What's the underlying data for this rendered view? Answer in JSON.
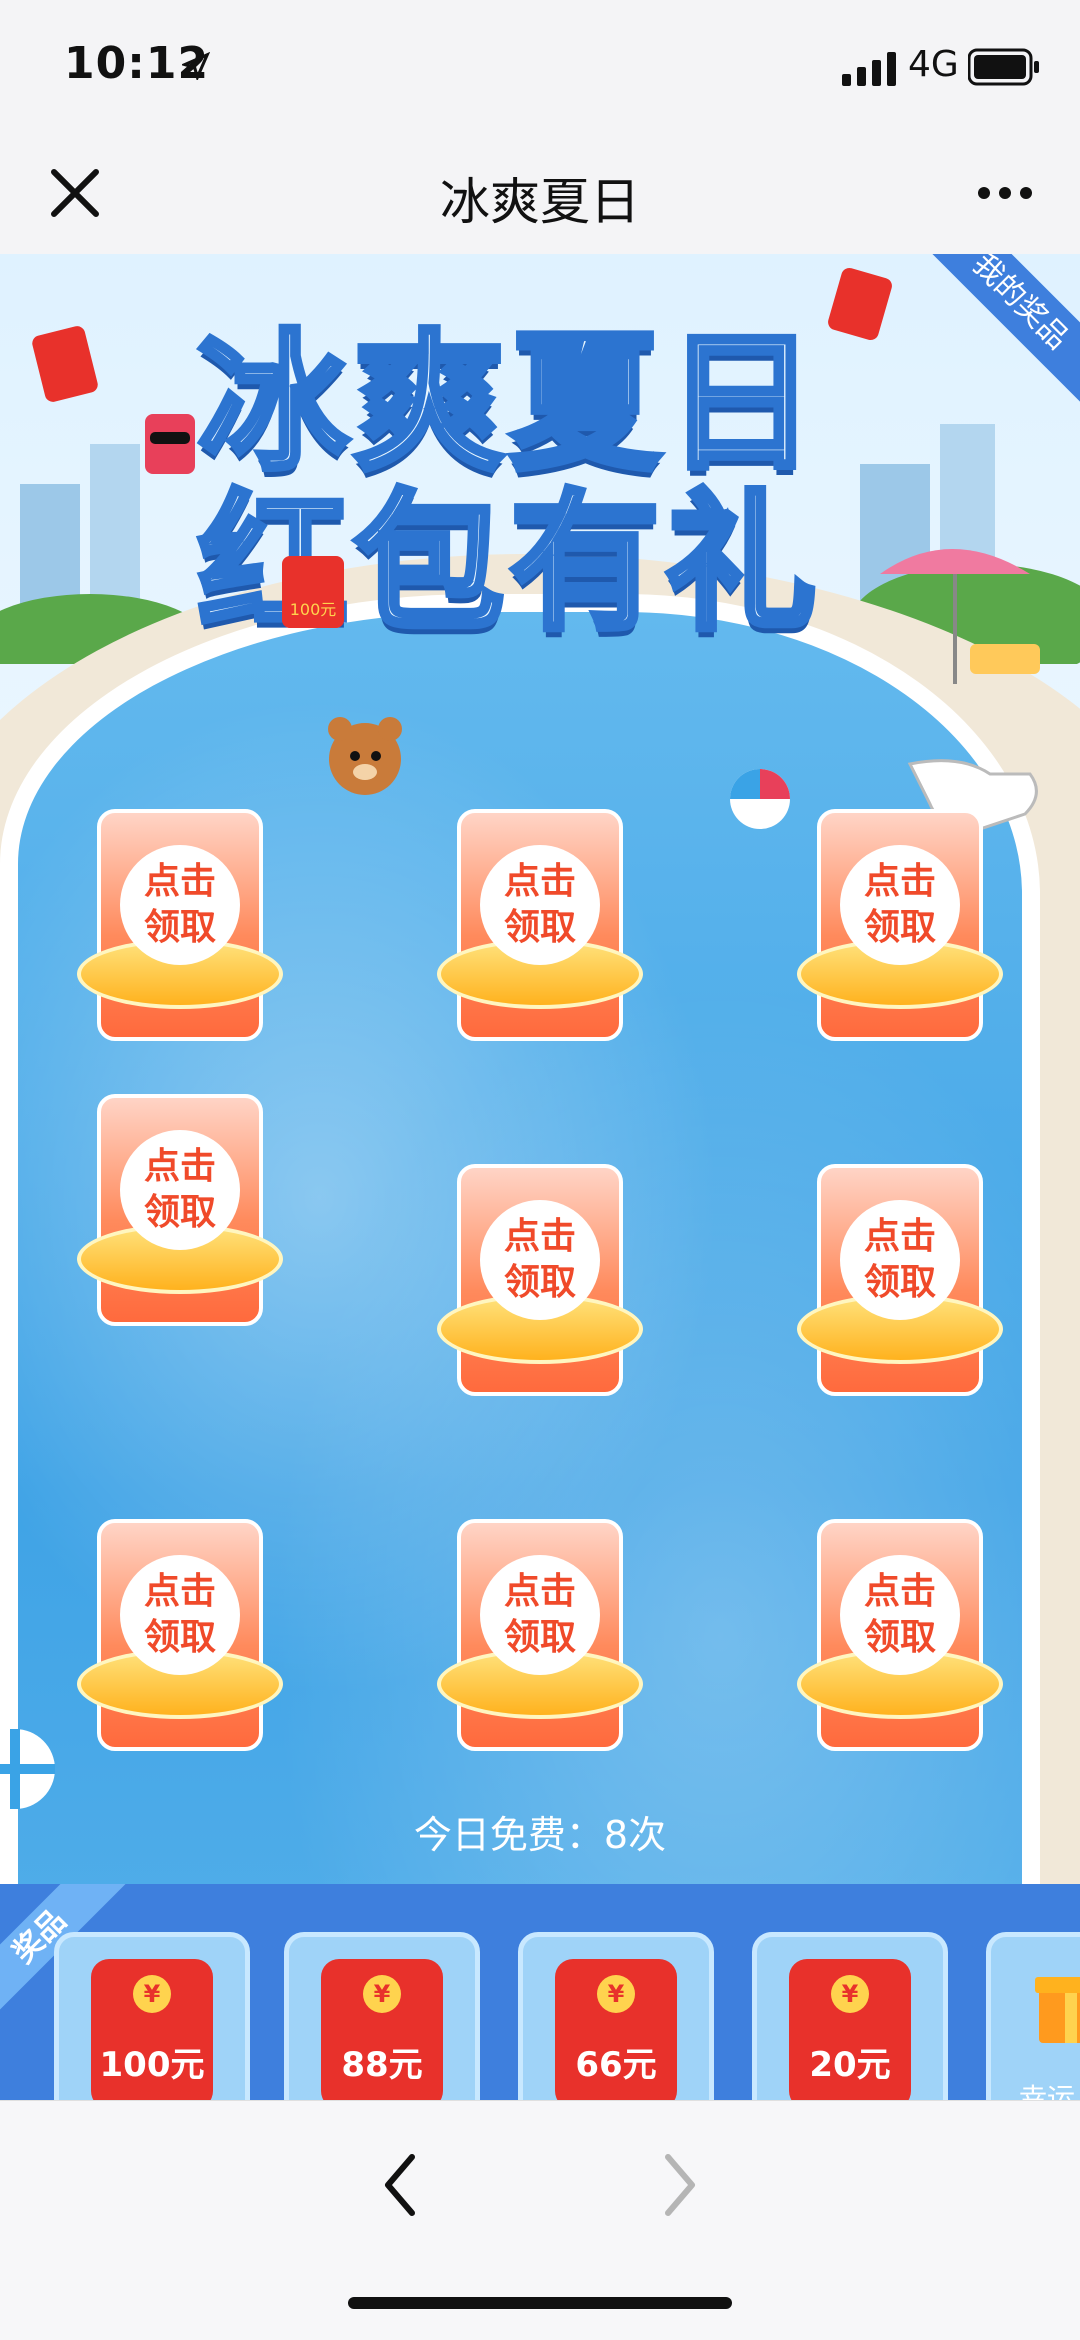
{
  "status_bar": {
    "time": "10:12",
    "network": "4G"
  },
  "nav": {
    "title": "冰爽夏日"
  },
  "banner": {
    "title_line1": "冰爽夏日",
    "title_line2": "红包有礼",
    "my_prizes": "我的奖品",
    "envelope_badge": "100元"
  },
  "grid": {
    "tile_label_line1": "点击",
    "tile_label_line2": "领取",
    "free_count": "今日免费：8次"
  },
  "prizes": {
    "ribbon": "奖品",
    "items": [
      {
        "amount": "100元"
      },
      {
        "amount": "88元"
      },
      {
        "amount": "66元"
      },
      {
        "amount": "20元"
      },
      {
        "label": "幸运"
      }
    ]
  },
  "colors": {
    "accent": "#3e7fdd",
    "envelope": "#e8312b",
    "tile": "#ff6a3d"
  }
}
